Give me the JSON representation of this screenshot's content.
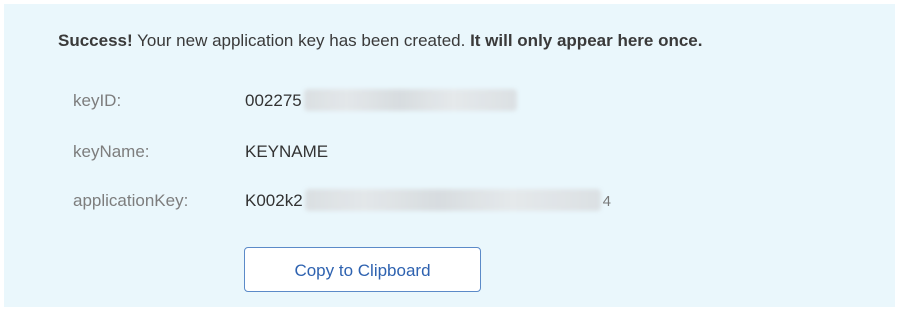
{
  "message": {
    "success_label": "Success!",
    "body_text": " Your new application key has been created. ",
    "emphasis_text": "It will only appear here once."
  },
  "fields": {
    "key_id": {
      "label": "keyID:",
      "value_visible": "002275"
    },
    "key_name": {
      "label": "keyName:",
      "value": "KEYNAME"
    },
    "application_key": {
      "label": "applicationKey:",
      "value_visible": "K002k2",
      "value_tail": "4"
    }
  },
  "actions": {
    "copy_label": "Copy to Clipboard"
  },
  "colors": {
    "panel_background": "#eaf7fc",
    "button_text": "#2e62b0",
    "button_border": "#5b8ac8",
    "label_text": "#7d7d7d"
  }
}
